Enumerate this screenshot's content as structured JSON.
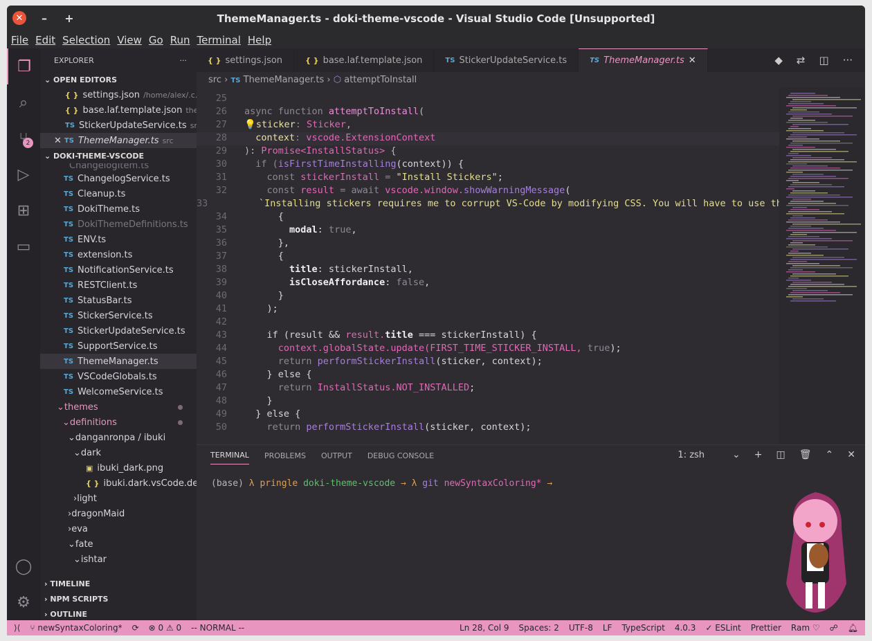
{
  "title": "ThemeManager.ts - doki-theme-vscode - Visual Studio Code [Unsupported]",
  "menu": [
    "File",
    "Edit",
    "Selection",
    "View",
    "Go",
    "Run",
    "Terminal",
    "Help"
  ],
  "explorer": {
    "title": "EXPLORER",
    "open_editors": "OPEN EDITORS",
    "project": "DOKI-THEME-VSCODE",
    "timeline": "TIMELINE",
    "npm": "NPM SCRIPTS",
    "outline": "OUTLINE",
    "open": [
      {
        "icon": "json",
        "name": "settings.json",
        "path": "/home/alex/.c..."
      },
      {
        "icon": "json",
        "name": "base.laf.template.json",
        "path": "the..."
      },
      {
        "icon": "ts",
        "name": "StickerUpdateService.ts",
        "path": "src"
      },
      {
        "icon": "ts",
        "name": "ThemeManager.ts",
        "path": "src",
        "active": true
      }
    ],
    "files": [
      {
        "name": "ChangelogService.ts",
        "icon": "ts",
        "indent": 1
      },
      {
        "name": "Cleanup.ts",
        "icon": "ts",
        "indent": 1
      },
      {
        "name": "DokiTheme.ts",
        "icon": "ts",
        "indent": 1
      },
      {
        "name": "DokiThemeDefinitions.ts",
        "icon": "ts",
        "indent": 1,
        "faded": true
      },
      {
        "name": "ENV.ts",
        "icon": "ts",
        "indent": 1
      },
      {
        "name": "extension.ts",
        "icon": "ts",
        "indent": 1
      },
      {
        "name": "NotificationService.ts",
        "icon": "ts",
        "indent": 1
      },
      {
        "name": "RESTClient.ts",
        "icon": "ts",
        "indent": 1
      },
      {
        "name": "StatusBar.ts",
        "icon": "ts",
        "indent": 1
      },
      {
        "name": "StickerService.ts",
        "icon": "ts",
        "indent": 1
      },
      {
        "name": "StickerUpdateService.ts",
        "icon": "ts",
        "indent": 1
      },
      {
        "name": "SupportService.ts",
        "icon": "ts",
        "indent": 1
      },
      {
        "name": "ThemeManager.ts",
        "icon": "ts",
        "indent": 1,
        "selected": true
      },
      {
        "name": "VSCodeGlobals.ts",
        "icon": "ts",
        "indent": 1
      },
      {
        "name": "WelcomeService.ts",
        "icon": "ts",
        "indent": 1
      },
      {
        "name": "themes",
        "icon": "open",
        "indent": 1,
        "pink": true,
        "dot": true
      },
      {
        "name": "definitions",
        "icon": "open",
        "indent": 2,
        "pink": true,
        "dot": true
      },
      {
        "name": "danganronpa / ibuki",
        "icon": "open",
        "indent": 3
      },
      {
        "name": "dark",
        "icon": "open",
        "indent": 4
      },
      {
        "name": "ibuki_dark.png",
        "icon": "img",
        "indent": 5
      },
      {
        "name": "ibuki.dark.vsCode.definit...",
        "icon": "json",
        "indent": 5
      },
      {
        "name": "light",
        "icon": "closed",
        "indent": 4
      },
      {
        "name": "dragonMaid",
        "icon": "closed",
        "indent": 3
      },
      {
        "name": "eva",
        "icon": "closed",
        "indent": 3
      },
      {
        "name": "fate",
        "icon": "open",
        "indent": 3
      },
      {
        "name": "ishtar",
        "icon": "open",
        "indent": 4
      }
    ]
  },
  "tabs": [
    {
      "icon": "json",
      "label": "settings.json"
    },
    {
      "icon": "json",
      "label": "base.laf.template.json"
    },
    {
      "icon": "ts",
      "label": "StickerUpdateService.ts"
    },
    {
      "icon": "ts",
      "label": "ThemeManager.ts",
      "active": true
    }
  ],
  "breadcrumb": [
    "src",
    "ThemeManager.ts",
    "attemptToInstall"
  ],
  "code": [
    {
      "n": "25",
      "t": []
    },
    {
      "n": "26",
      "t": [
        [
          "async function ",
          "k"
        ],
        [
          "attemptToInstall",
          "f"
        ],
        [
          "(",
          "pl"
        ]
      ]
    },
    {
      "n": "27",
      "t": [
        [
          "💡",
          "pl"
        ],
        [
          "sticker",
          "p"
        ],
        [
          ": ",
          "k"
        ],
        [
          "Sticker",
          "t"
        ],
        [
          ",",
          "pl"
        ]
      ]
    },
    {
      "n": "28",
      "cur": true,
      "t": [
        [
          "  context",
          "p"
        ],
        [
          ": ",
          "k"
        ],
        [
          "vscode.ExtensionContext",
          "t"
        ]
      ]
    },
    {
      "n": "29",
      "t": [
        [
          "): ",
          "pl"
        ],
        [
          "Promise<InstallStatus>",
          "t"
        ],
        [
          " {",
          "pl"
        ]
      ]
    },
    {
      "n": "30",
      "t": [
        [
          "  if (",
          "k"
        ],
        [
          "isFirstTimeInstalling",
          "m"
        ],
        [
          "(context)) {",
          "w"
        ]
      ]
    },
    {
      "n": "31",
      "t": [
        [
          "    const ",
          "k"
        ],
        [
          "stickerInstall",
          "t"
        ],
        [
          " = ",
          "k"
        ],
        [
          "\"Install Stickers\"",
          "s"
        ],
        [
          ";",
          "w"
        ]
      ]
    },
    {
      "n": "32",
      "t": [
        [
          "    const ",
          "k"
        ],
        [
          "result",
          "t"
        ],
        [
          " = await ",
          "k"
        ],
        [
          "vscode.window.",
          "t"
        ],
        [
          "showWarningMessage",
          "m"
        ],
        [
          "(",
          "w"
        ]
      ]
    },
    {
      "n": "33",
      "t": [
        [
          "      `Installing stickers requires me to corrupt VS-Code by modifying CSS. You will have to use the",
          "s"
        ]
      ]
    },
    {
      "n": "34",
      "t": [
        [
          "      {",
          "w"
        ]
      ]
    },
    {
      "n": "35",
      "t": [
        [
          "        modal",
          "b"
        ],
        [
          ": ",
          "w"
        ],
        [
          "true",
          "k"
        ],
        [
          ",",
          "w"
        ]
      ]
    },
    {
      "n": "36",
      "t": [
        [
          "      },",
          "w"
        ]
      ]
    },
    {
      "n": "37",
      "t": [
        [
          "      {",
          "w"
        ]
      ]
    },
    {
      "n": "38",
      "t": [
        [
          "        title",
          "b"
        ],
        [
          ": stickerInstall,",
          "w"
        ]
      ]
    },
    {
      "n": "39",
      "t": [
        [
          "        isCloseAffordance",
          "b"
        ],
        [
          ": ",
          "w"
        ],
        [
          "false",
          "k"
        ],
        [
          ",",
          "w"
        ]
      ]
    },
    {
      "n": "40",
      "t": [
        [
          "      }",
          "w"
        ]
      ]
    },
    {
      "n": "41",
      "t": [
        [
          "    );",
          "w"
        ]
      ]
    },
    {
      "n": "42",
      "t": []
    },
    {
      "n": "43",
      "t": [
        [
          "    if (result && ",
          "w"
        ],
        [
          "result.",
          "t"
        ],
        [
          "title",
          "b"
        ],
        [
          " === stickerInstall) {",
          "w"
        ]
      ]
    },
    {
      "n": "44",
      "t": [
        [
          "      context",
          "t"
        ],
        [
          ".globalState.update(FIRST_TIME_STICKER_INSTALL, ",
          "t"
        ],
        [
          "true",
          "k"
        ],
        [
          ");",
          "w"
        ]
      ]
    },
    {
      "n": "45",
      "t": [
        [
          "      return ",
          "k"
        ],
        [
          "performStickerInstall",
          "m"
        ],
        [
          "(sticker, context);",
          "w"
        ]
      ]
    },
    {
      "n": "46",
      "t": [
        [
          "    } else {",
          "w"
        ]
      ]
    },
    {
      "n": "47",
      "t": [
        [
          "      return ",
          "k"
        ],
        [
          "InstallStatus.NOT_INSTALLED",
          "t"
        ],
        [
          ";",
          "w"
        ]
      ]
    },
    {
      "n": "48",
      "t": [
        [
          "    }",
          "w"
        ]
      ]
    },
    {
      "n": "49",
      "t": [
        [
          "  } else {",
          "w"
        ]
      ]
    },
    {
      "n": "50",
      "t": [
        [
          "    return ",
          "k"
        ],
        [
          "performStickerInstall",
          "m"
        ],
        [
          "(sticker, context);",
          "w"
        ]
      ]
    }
  ],
  "panel": {
    "tabs": [
      "TERMINAL",
      "PROBLEMS",
      "OUTPUT",
      "DEBUG CONSOLE"
    ],
    "shell": "1: zsh",
    "prompt": [
      [
        "(base) ",
        "#b9b5bd"
      ],
      [
        "λ ",
        "#e0a050"
      ],
      [
        "pringle ",
        "#e0a050"
      ],
      [
        "doki-theme-vscode ",
        "#5cc26b"
      ],
      [
        "→ ",
        "#e0a050"
      ],
      [
        "λ ",
        "#e0a050"
      ],
      [
        "git ",
        "#a580da"
      ],
      [
        "newSyntaxColoring* ",
        "#e069b6"
      ],
      [
        "→",
        "#e0a050"
      ]
    ]
  },
  "status": {
    "branch": "newSyntaxColoring*",
    "problems": "⊗ 0 ⚠ 0",
    "mode": "-- NORMAL --",
    "right": [
      "Ln 28, Col 9",
      "Spaces: 2",
      "UTF-8",
      "LF",
      "TypeScript",
      "4.0.3",
      "✓ ESLint",
      "Prettier",
      "Ram ♡"
    ]
  },
  "colors": {
    "accent": "#e896c0",
    "editor_bg": "#2e2b31"
  }
}
